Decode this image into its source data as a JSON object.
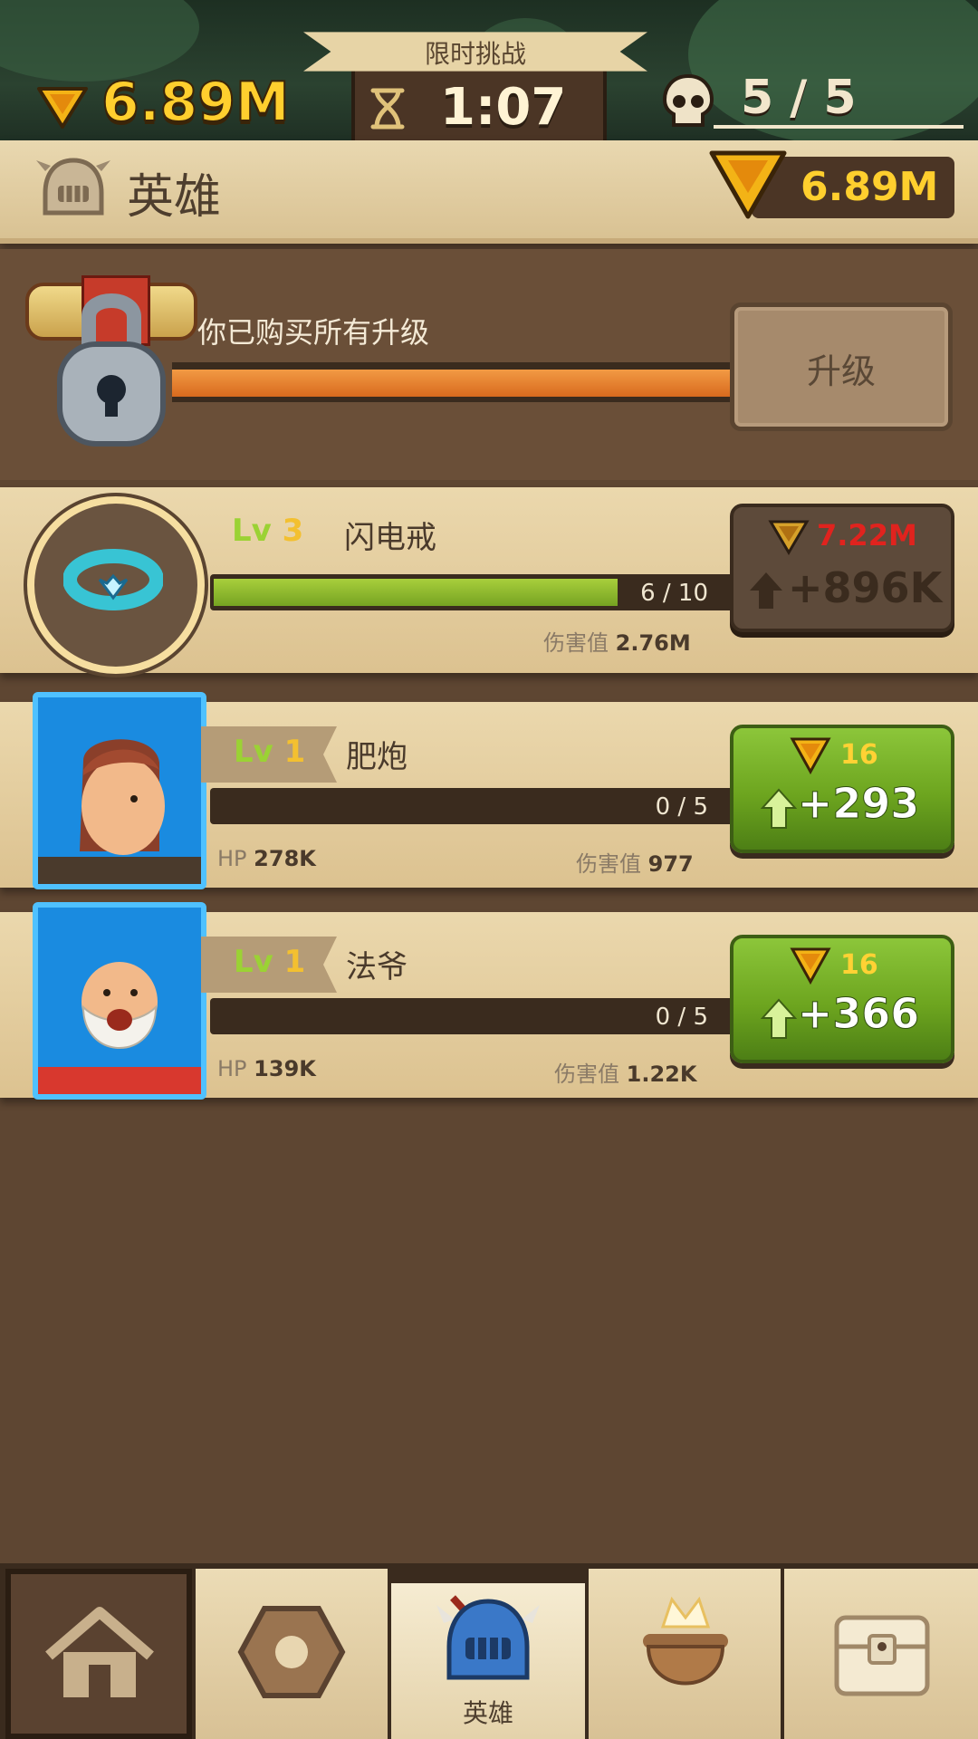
{
  "top": {
    "gold": "6.89M",
    "challenge_label": "限时挑战",
    "timer": "1:07",
    "skull_count": "5 / 5"
  },
  "header": {
    "title": "英雄",
    "gold": "6.89M"
  },
  "upgrade": {
    "message": "你已购买所有升级",
    "button": "升级",
    "progress": 1.0
  },
  "items": [
    {
      "lv_label": "Lv",
      "lv": "3",
      "name": "闪电戒",
      "progress_text": "6 / 10",
      "progress": 0.6,
      "damage_label": "伤害值",
      "damage": "2.76M",
      "cost": "7.22M",
      "gain": "+896K",
      "enabled": false
    },
    {
      "lv_label": "Lv",
      "lv": "1",
      "name": "肥炮",
      "progress_text": "0 / 5",
      "progress": 0,
      "hp_label": "HP",
      "hp": "278K",
      "damage_label": "伤害值",
      "damage": "977",
      "cost": "16",
      "gain": "+293",
      "enabled": true
    },
    {
      "lv_label": "Lv",
      "lv": "1",
      "name": "法爷",
      "progress_text": "0 / 5",
      "progress": 0,
      "hp_label": "HP",
      "hp": "139K",
      "damage_label": "伤害值",
      "damage": "1.22K",
      "cost": "16",
      "gain": "+366",
      "enabled": true
    }
  ],
  "nav": {
    "active_label": "英雄",
    "tabs": [
      "home-icon",
      "rune-icon",
      "hero-helmet-icon",
      "cauldron-icon",
      "treasure-chest-icon"
    ]
  },
  "colors": {
    "gold": "#ffcf2e",
    "cost_red": "#e0231e",
    "green_button": "#7ab52a",
    "bar_green": "#8db72e",
    "bar_orange": "#e5782a"
  }
}
